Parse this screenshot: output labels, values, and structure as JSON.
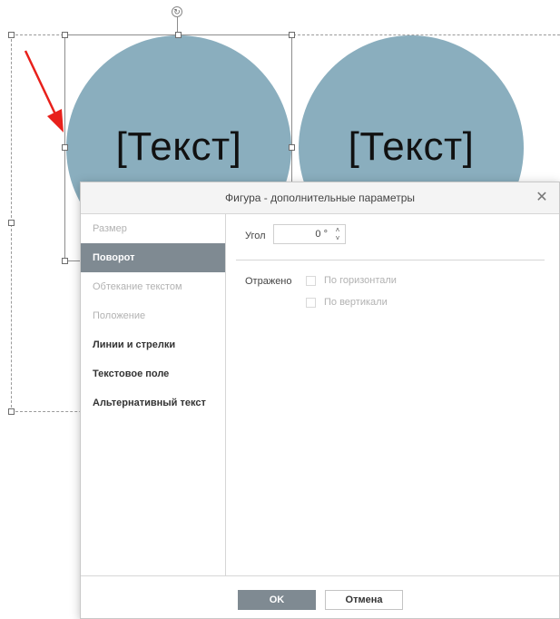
{
  "canvas": {
    "shapes": [
      {
        "text": "[Текст]"
      },
      {
        "text": "[Текст]"
      }
    ],
    "shape_color": "#8aaebe",
    "arrow_color": "#e8201b"
  },
  "dialog": {
    "title": "Фигура - дополнительные параметры",
    "nav": [
      {
        "label": "Размер",
        "state": "disabled"
      },
      {
        "label": "Поворот",
        "state": "active"
      },
      {
        "label": "Обтекание текстом",
        "state": "disabled"
      },
      {
        "label": "Положение",
        "state": "disabled"
      },
      {
        "label": "Линии и стрелки",
        "state": "enabled"
      },
      {
        "label": "Текстовое поле",
        "state": "enabled"
      },
      {
        "label": "Альтернативный текст",
        "state": "enabled"
      }
    ],
    "angle_label": "Угол",
    "angle_value": "0 °",
    "flip_label": "Отражено",
    "flip_horizontal": "По горизонтали",
    "flip_vertical": "По вертикали",
    "ok_label": "OK",
    "cancel_label": "Отмена",
    "accent_color": "#7f8a92"
  }
}
